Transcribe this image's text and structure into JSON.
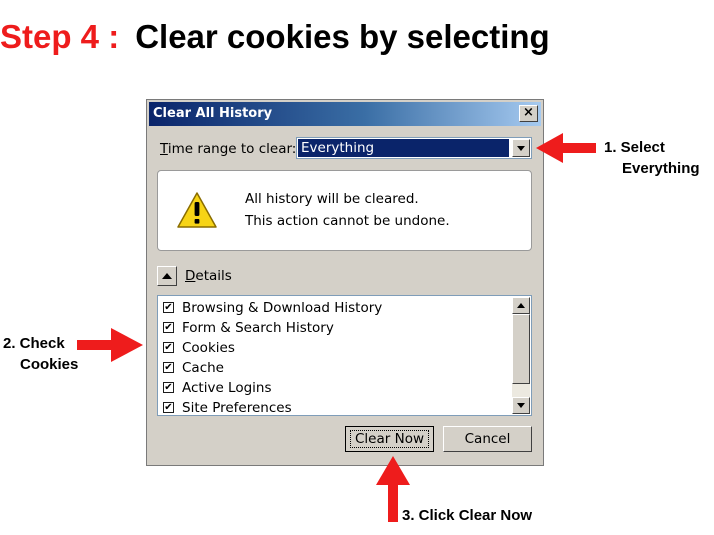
{
  "heading": {
    "step": "Step 4 :",
    "text": "Clear cookies by selecting"
  },
  "dialog": {
    "title": "Clear All History",
    "close_label": "×",
    "time_range_label_first": "T",
    "time_range_label_rest": "ime range to clear:",
    "time_range_value": "Everything",
    "warning_line1": "All history will be cleared.",
    "warning_line2": "This action cannot be undone.",
    "details_label_first": "D",
    "details_label_rest": "etails",
    "items": [
      {
        "label": "Browsing & Download History",
        "checked": true
      },
      {
        "label": "Form & Search History",
        "checked": true
      },
      {
        "label": "Cookies",
        "checked": true
      },
      {
        "label": "Cache",
        "checked": true
      },
      {
        "label": "Active Logins",
        "checked": true
      },
      {
        "label": "Site Preferences",
        "checked": true
      }
    ],
    "check_mark": "✔",
    "clear_now_label": "Clear Now",
    "cancel_label": "Cancel"
  },
  "annotations": {
    "select_line1": "1. Select",
    "select_line2": "Everything",
    "check_line1": "2. Check",
    "check_line2": "Cookies",
    "click": "3. Click Clear Now"
  },
  "colors": {
    "accent_red": "#ee1c1c",
    "title_blue": "#0a246a"
  }
}
